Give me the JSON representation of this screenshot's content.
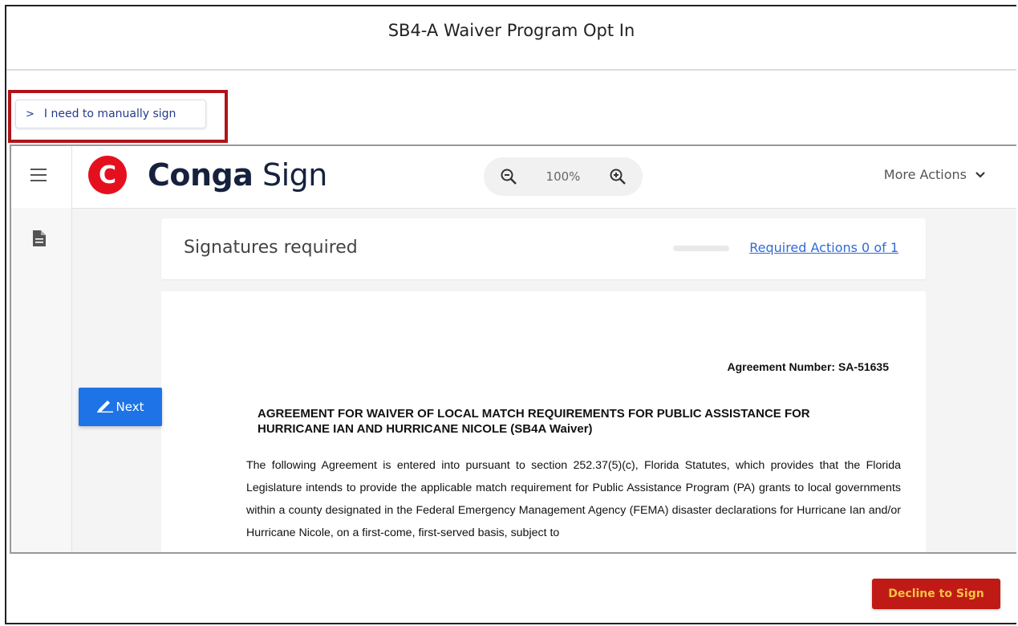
{
  "page": {
    "title": "SB4-A Waiver Program Opt In"
  },
  "manual_sign": {
    "label": "I need to manually sign"
  },
  "conga": {
    "logo_letter": "C",
    "logo_brand": "Conga",
    "logo_product": "Sign",
    "zoom_level": "100%",
    "more_actions": "More Actions"
  },
  "signatures": {
    "title": "Signatures required",
    "required_actions": "Required Actions 0 of 1"
  },
  "document": {
    "agreement_number": "Agreement Number: SA-51635",
    "heading": "AGREEMENT FOR WAIVER OF LOCAL MATCH REQUIREMENTS FOR PUBLIC ASSISTANCE FOR HURRICANE IAN AND HURRICANE NICOLE (SB4A Waiver)",
    "body": "The following Agreement is entered into pursuant to section 252.37(5)(c), Florida Statutes, which provides that the Florida Legislature intends to provide the applicable match requirement for Public Assistance Program (PA) grants to local governments within a county designated in the Federal Emergency Management Agency (FEMA) disaster declarations for Hurricane Ian and/or Hurricane Nicole, on a first-come, first-served basis, subject to"
  },
  "next_button": {
    "label": "Next"
  },
  "decline_button": {
    "label": "Decline to Sign"
  },
  "colors": {
    "brand_red": "#e5101e",
    "highlight_red": "#b01419",
    "next_blue": "#1e74e6",
    "decline_red": "#c01a17",
    "decline_text": "#f5c242",
    "link_blue": "#2f6bd6"
  }
}
